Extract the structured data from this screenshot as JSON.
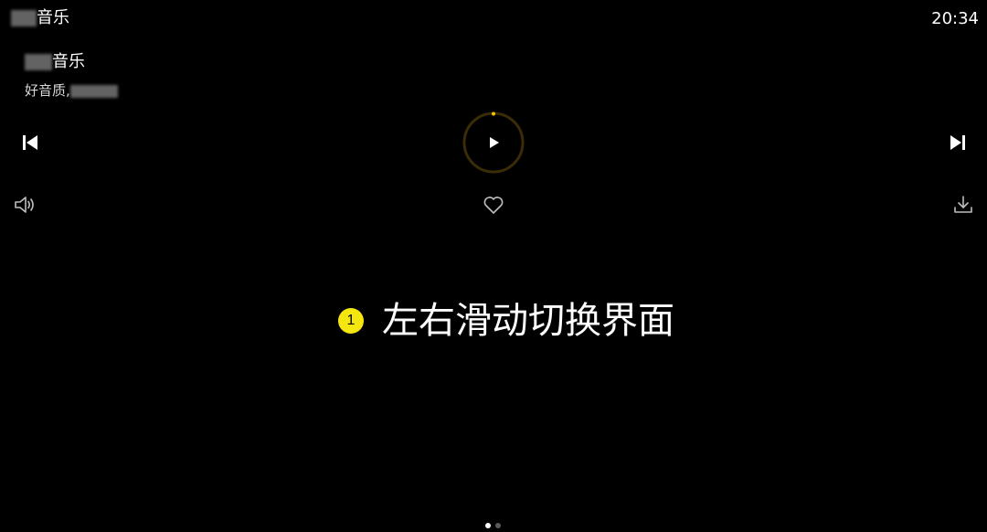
{
  "status_bar": {
    "app_name": "音乐",
    "time": "20:34"
  },
  "track": {
    "title": "音乐",
    "subtitle": "好音质,"
  },
  "controls": {
    "prev_icon": "skip-previous-icon",
    "play_icon": "play-icon",
    "next_icon": "skip-next-icon",
    "volume_icon": "volume-icon",
    "favorite_icon": "heart-icon",
    "download_icon": "download-icon",
    "accent_color": "#f5c400",
    "ring_color": "#3a2c06"
  },
  "hint": {
    "badge": "1",
    "text": "左右滑动切换界面",
    "badge_color": "#f5e60f"
  },
  "pager": {
    "page_count": 2,
    "active_index": 0
  }
}
